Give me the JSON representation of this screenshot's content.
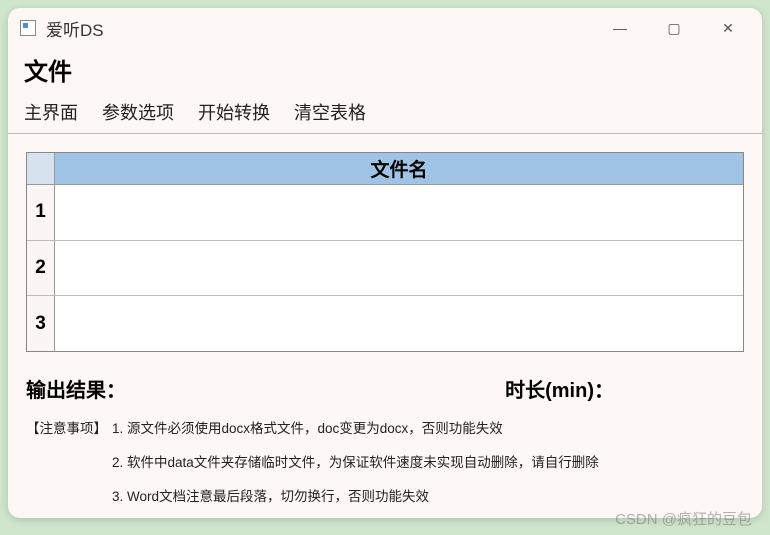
{
  "titlebar": {
    "app_title": "爱听DS"
  },
  "menu": {
    "title": "文件",
    "items": [
      "主界面",
      "参数选项",
      "开始转换",
      "清空表格"
    ]
  },
  "table": {
    "col_header": "文件名",
    "rows": [
      {
        "num": "1",
        "filename": ""
      },
      {
        "num": "2",
        "filename": ""
      },
      {
        "num": "3",
        "filename": ""
      }
    ]
  },
  "status": {
    "output_label": "输出结果：",
    "duration_label": "时长(min)："
  },
  "notes": {
    "label": "【注意事项】",
    "items": [
      "1. 源文件必须使用docx格式文件，doc变更为docx，否则功能失效",
      "2. 软件中data文件夹存储临时文件，为保证软件速度未实现自动删除，请自行删除",
      "3. Word文档注意最后段落，切勿换行，否则功能失效"
    ]
  },
  "watermark": "CSDN @疯狂的豆包"
}
